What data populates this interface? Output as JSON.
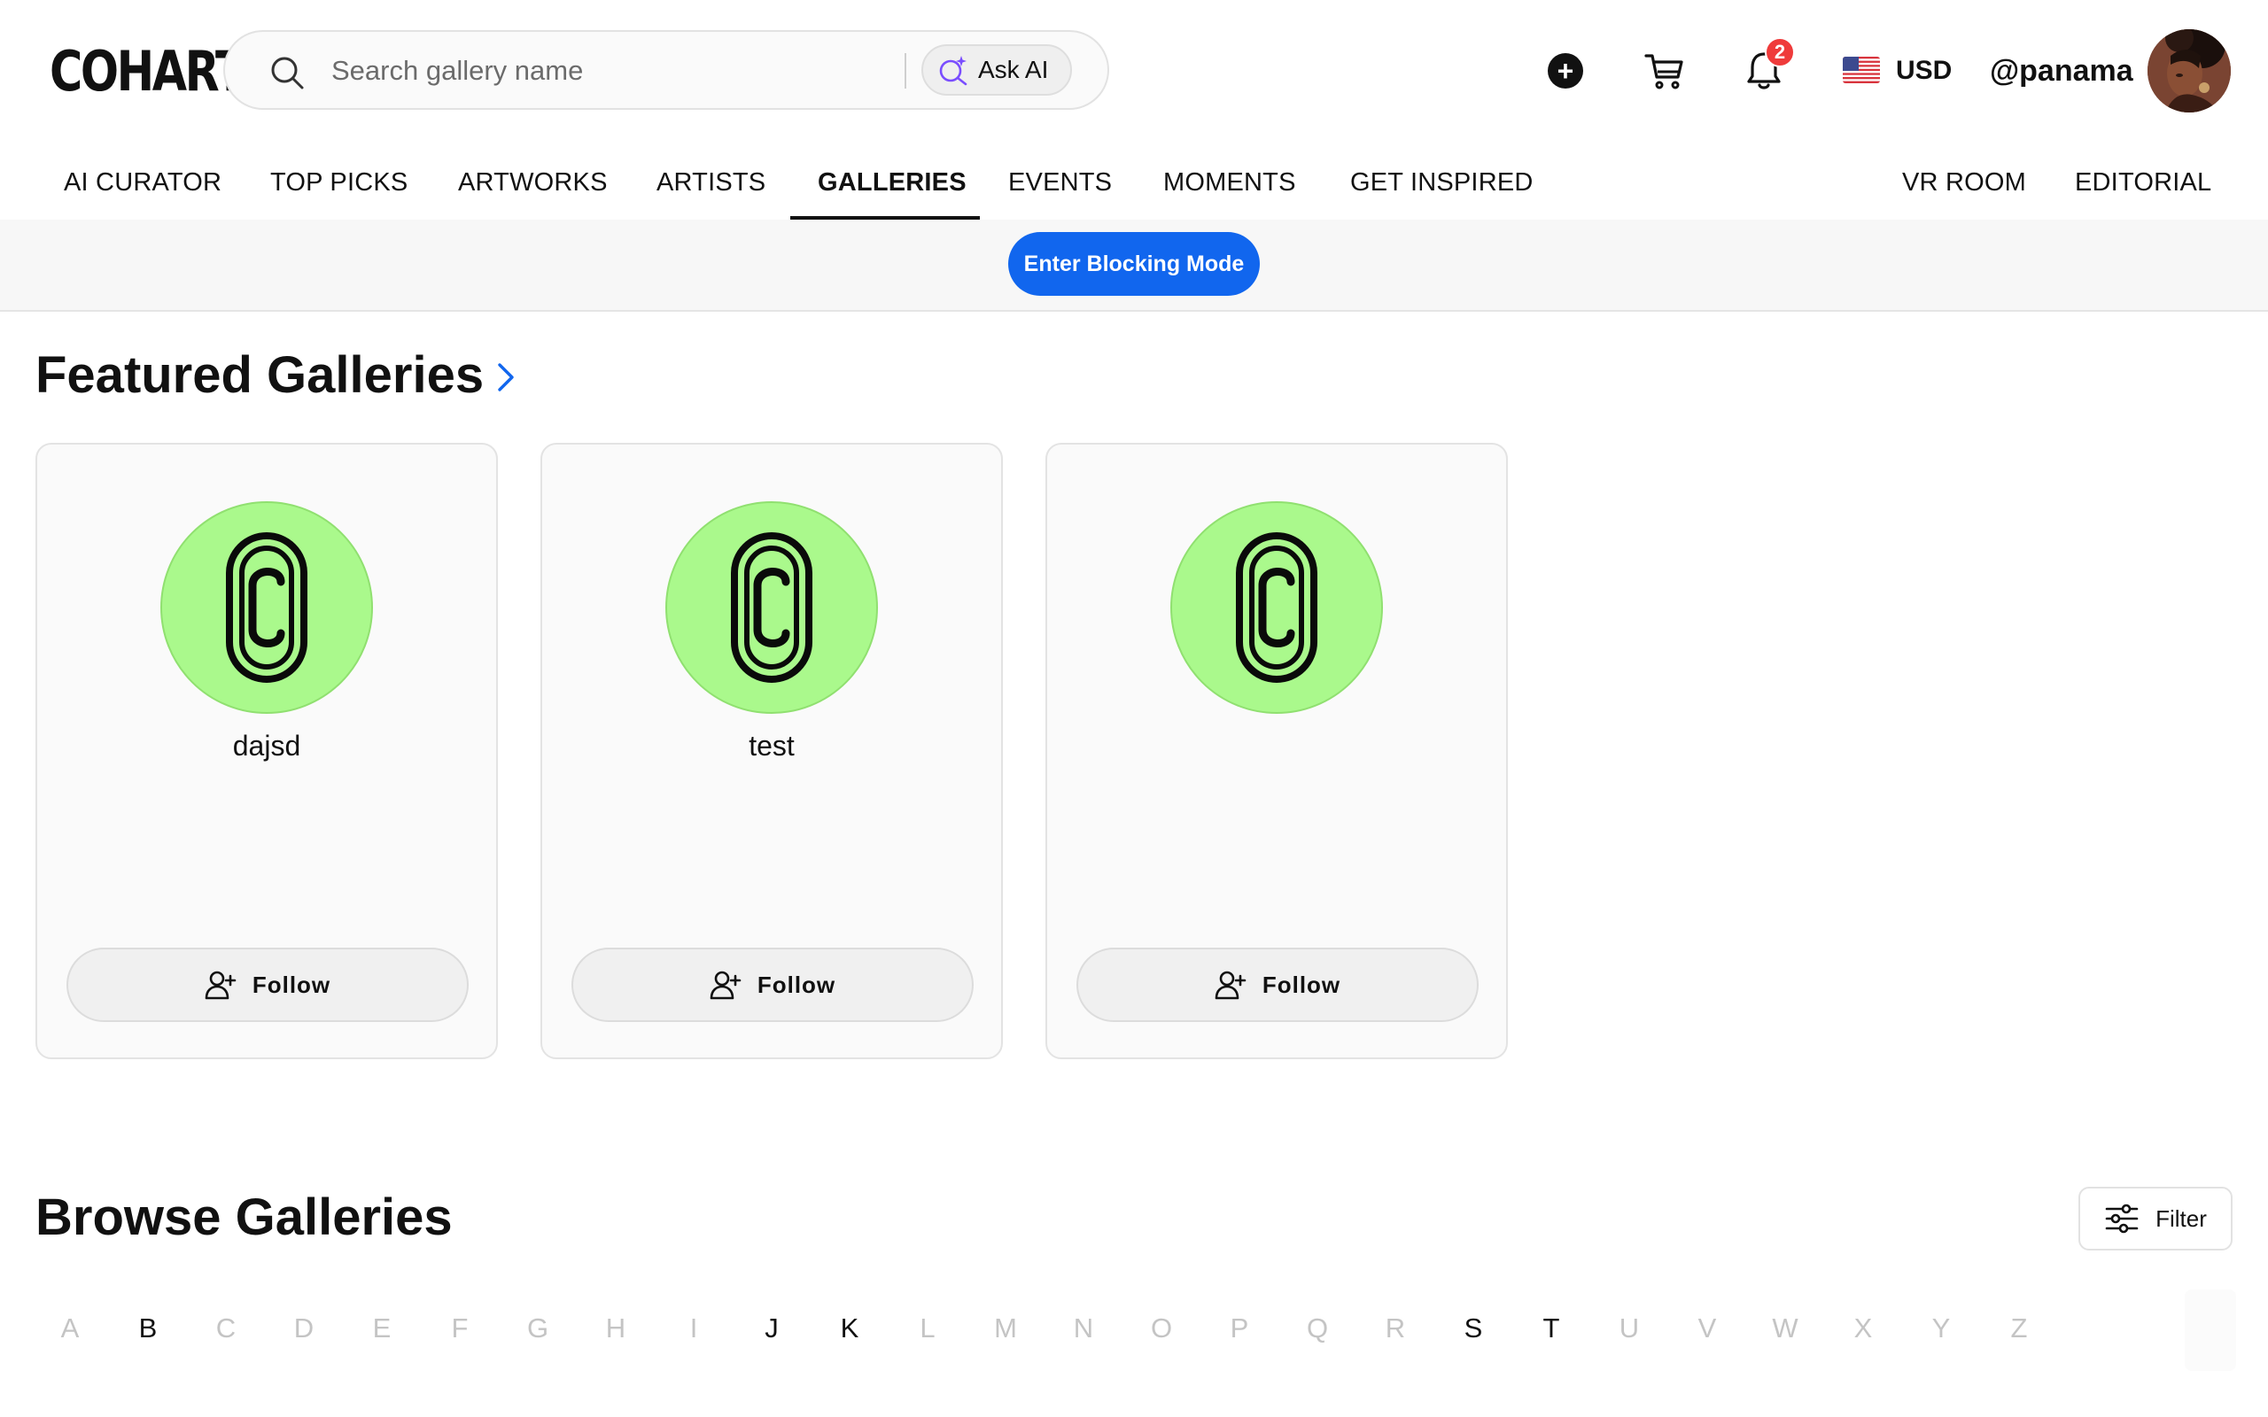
{
  "header": {
    "logo": "COHART",
    "search_placeholder": "Search gallery name",
    "ask_ai_label": "Ask AI",
    "notification_count": "2",
    "currency": "USD",
    "username": "@panama"
  },
  "nav": {
    "items": [
      "AI CURATOR",
      "TOP PICKS",
      "ARTWORKS",
      "ARTISTS",
      "GALLERIES",
      "EVENTS",
      "MOMENTS",
      "GET INSPIRED"
    ],
    "right_items": [
      "VR ROOM",
      "EDITORIAL"
    ],
    "active": "GALLERIES"
  },
  "blocking": {
    "button_label": "Enter Blocking Mode"
  },
  "featured": {
    "title": "Featured Galleries",
    "cards": [
      {
        "name": "dajsd",
        "follow_label": "Follow"
      },
      {
        "name": "test",
        "follow_label": "Follow"
      },
      {
        "name": "",
        "follow_label": "Follow"
      }
    ]
  },
  "browse": {
    "title": "Browse Galleries",
    "filter_label": "Filter",
    "letters": [
      "A",
      "B",
      "C",
      "D",
      "E",
      "F",
      "G",
      "H",
      "I",
      "J",
      "K",
      "L",
      "M",
      "N",
      "O",
      "P",
      "Q",
      "R",
      "S",
      "T",
      "U",
      "V",
      "W",
      "X",
      "Y",
      "Z"
    ],
    "enabled_letters": [
      "B",
      "J",
      "K",
      "S",
      "T"
    ]
  },
  "colors": {
    "accent": "#1166ee",
    "logo_bg": "#aaf98c",
    "badge": "#ef3b3b"
  }
}
